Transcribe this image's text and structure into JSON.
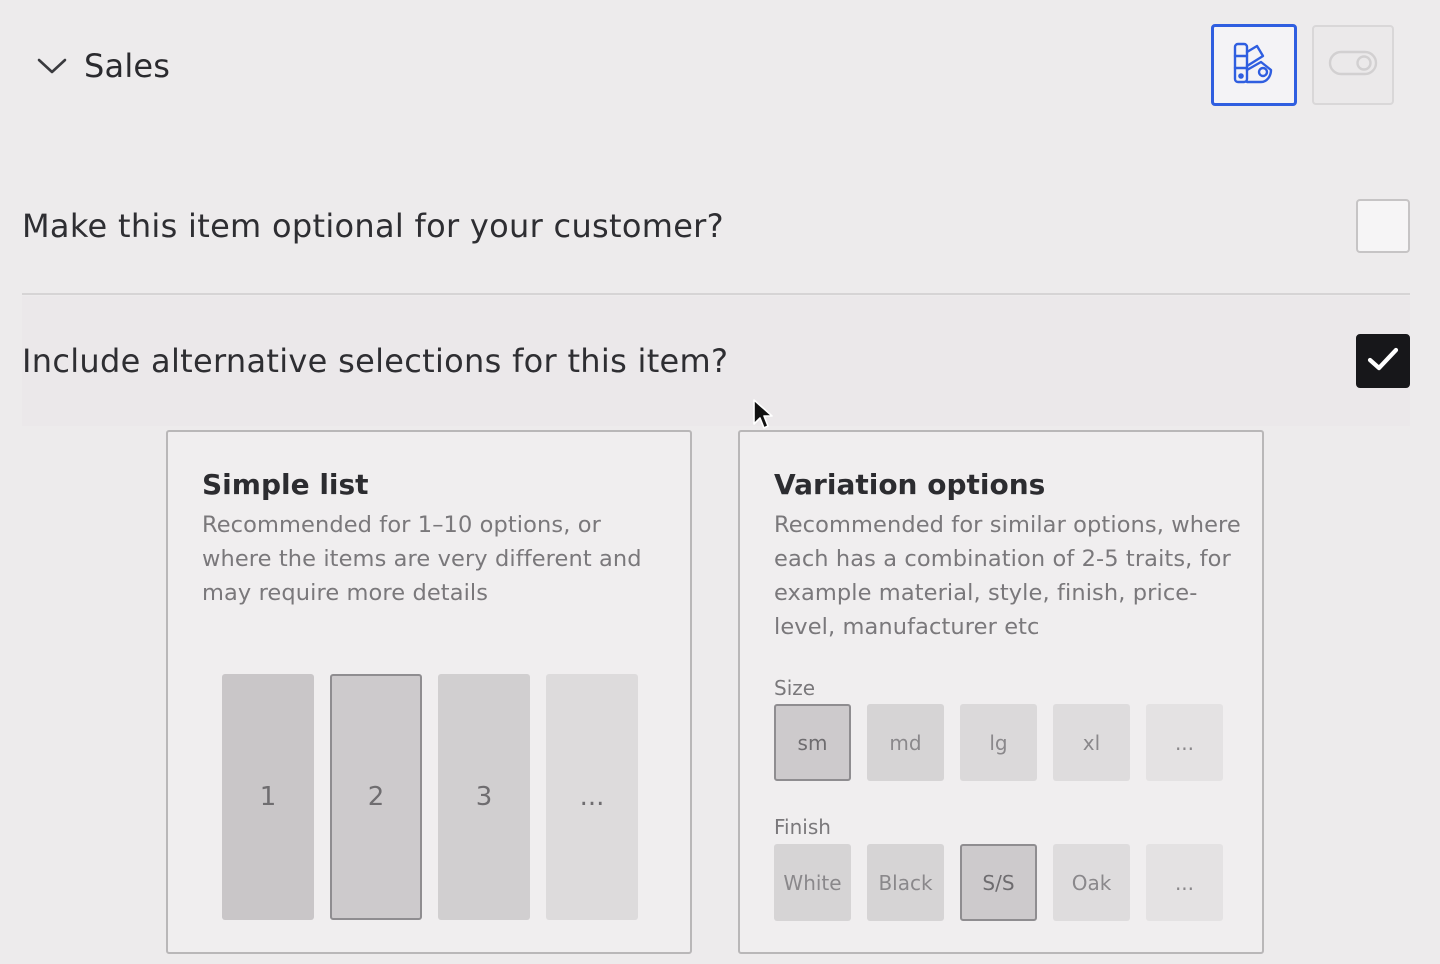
{
  "header": {
    "section_title": "Sales",
    "icons": {
      "collapse": "chevron-down-icon",
      "design_view": "design-palette-icon",
      "toggle_view": "toggle-switch-icon"
    },
    "colors": {
      "active_accent": "#2f5ee0"
    }
  },
  "questions": {
    "optional": {
      "label": "Make this item optional for your customer?",
      "checked": false
    },
    "alternative": {
      "label": "Include alternative selections for this item?",
      "checked": true
    }
  },
  "cards": {
    "simple_list": {
      "title": "Simple list",
      "description": "Recommended for 1–10 options, or where the items are very different and may require more details",
      "tiles": [
        "1",
        "2",
        "3",
        "..."
      ],
      "selected_index": 1
    },
    "variation_options": {
      "title": "Variation options",
      "description": "Recommended for similar options, where each has a combination of 2-5 traits, for example material, style, finish, price-level, manufacturer etc",
      "size": {
        "label": "Size",
        "options": [
          "sm",
          "md",
          "lg",
          "xl",
          "..."
        ],
        "selected_index": 0
      },
      "finish": {
        "label": "Finish",
        "options": [
          "White",
          "Black",
          "S/S",
          "Oak",
          "..."
        ],
        "selected_index": 2
      }
    }
  }
}
